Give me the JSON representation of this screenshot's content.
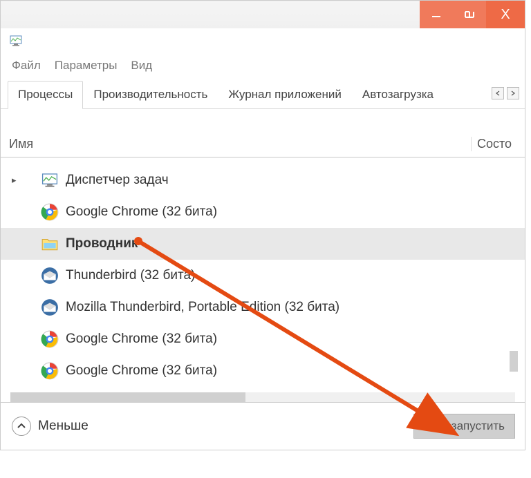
{
  "titlebar": {
    "close": "X"
  },
  "menubar": {
    "file": "Файл",
    "params": "Параметры",
    "view": "Вид"
  },
  "tabs": {
    "processes": "Процессы",
    "performance": "Производительность",
    "app_history": "Журнал приложений",
    "startup": "Автозагрузка"
  },
  "columns": {
    "name": "Имя",
    "status": "Состо"
  },
  "processes": {
    "task_manager": "Диспетчер задач",
    "chrome1": "Google Chrome (32 бита)",
    "explorer": "Проводник",
    "thunderbird": "Thunderbird (32 бита)",
    "thunderbird_portable": "Mozilla Thunderbird, Portable Edition (32 бита)",
    "chrome2": "Google Chrome (32 бита)",
    "chrome3": "Google Chrome (32 бита)"
  },
  "footer": {
    "less": "Меньше",
    "restart": "Перезапустить"
  }
}
